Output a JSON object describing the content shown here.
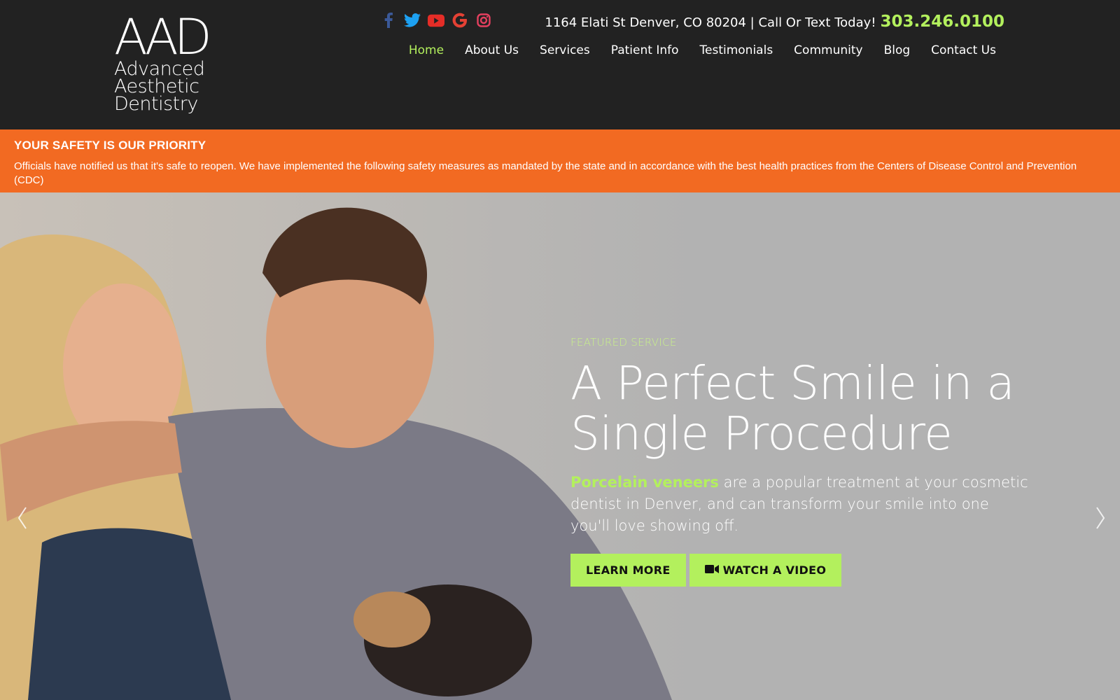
{
  "header": {
    "logo": {
      "mark": "AAD",
      "lines": [
        "Advanced",
        "Aesthetic",
        "Dentistry"
      ]
    },
    "social": [
      {
        "name": "facebook-icon",
        "color": "#3b5998"
      },
      {
        "name": "twitter-icon",
        "color": "#1da1f2"
      },
      {
        "name": "youtube-icon",
        "color": "#e52d27"
      },
      {
        "name": "google-icon",
        "color": "#e44134"
      },
      {
        "name": "instagram-icon",
        "color": "#e4405f"
      }
    ],
    "address": "1164 Elati St Denver, CO 80204 | Call Or Text Today!",
    "phone": "303.246.0100",
    "nav": [
      "Home",
      "About Us",
      "Services",
      "Patient Info",
      "Testimonials",
      "Community",
      "Blog",
      "Contact Us"
    ]
  },
  "banner": {
    "title": "YOUR SAFETY IS OUR PRIORITY",
    "text": "Officials have notified us that it's safe to reopen. We have implemented the following safety measures as mandated by the state and in accordance with the best health practices from the Centers of Disease Control and Prevention (CDC)",
    "color": "#f26a22"
  },
  "hero": {
    "eyebrow": "FEATURED SERVICE",
    "headline": "A Perfect Smile in a Single Procedure",
    "desc_highlight": "Porcelain veneers",
    "desc_rest": " are a popular treatment at your cosmetic dentist in Denver, and can transform your smile into one you'll love showing off.",
    "learn_more": "LEARN MORE",
    "watch_video": "WATCH A VIDEO"
  },
  "colors": {
    "accent": "#b3f05d",
    "header_bg": "#222222",
    "hero_bg": "#b2b2b2"
  }
}
